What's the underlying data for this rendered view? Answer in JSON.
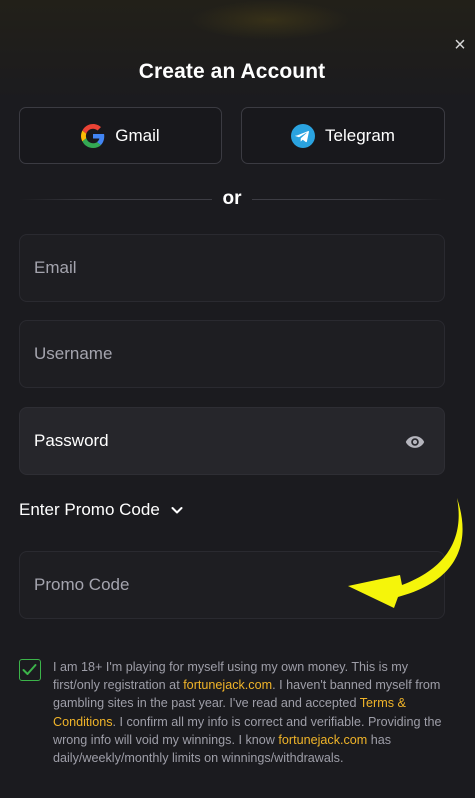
{
  "modal": {
    "title": "Create an Account",
    "close_label": "×"
  },
  "social": {
    "gmail_label": "Gmail",
    "gmail_icon": "google-icon",
    "telegram_label": "Telegram",
    "telegram_icon": "telegram-icon"
  },
  "divider_text": "or",
  "form": {
    "email_placeholder": "Email",
    "email_value": "",
    "username_placeholder": "Username",
    "username_value": "",
    "password_placeholder": "Password",
    "password_value": "",
    "password_icon": "eye-icon",
    "promo_toggle_label": "Enter Promo Code",
    "promo_toggle_icon": "chevron-down-icon",
    "promo_placeholder": "Promo Code",
    "promo_value": ""
  },
  "annotation": {
    "arrow_color": "#f5f50a",
    "arrow_icon": "arrow-icon"
  },
  "consent": {
    "checked": true,
    "text_1": "I am 18+ I'm playing for myself using my own money. This is my first/only registration at ",
    "link_1": "fortunejack.com",
    "text_2": ". I haven't banned myself from gambling sites in the past year. I've read and accepted ",
    "link_terms": "Terms & Conditions",
    "text_3": ". I confirm all my info is correct and verifiable. Providing the wrong info will void my winnings. I know ",
    "link_2": "fortunejack.com",
    "text_4": " has daily/weekly/monthly limits on winnings/withdrawals."
  },
  "colors": {
    "background": "#1b1b1f",
    "accent_link": "#f0b429",
    "checkbox_green": "#3cb44a",
    "telegram_blue": "#2aa3e0"
  }
}
